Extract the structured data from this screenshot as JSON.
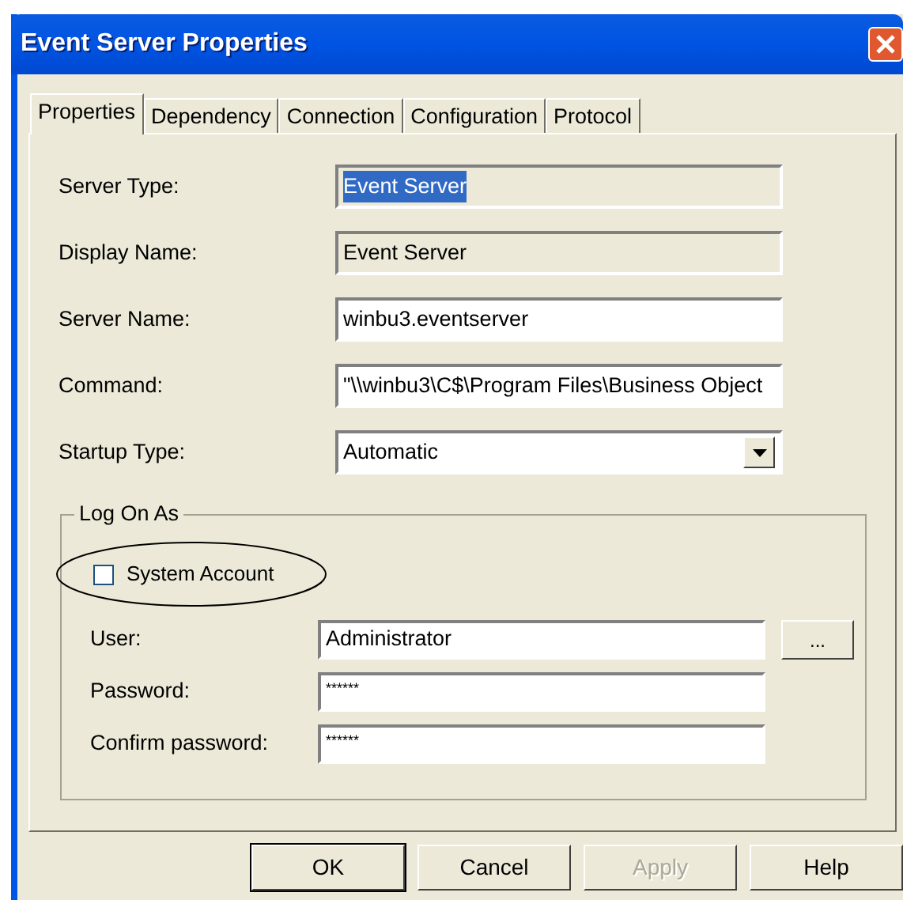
{
  "window": {
    "title": "Event Server Properties"
  },
  "tabs": [
    {
      "label": "Properties",
      "selected": true
    },
    {
      "label": "Dependency",
      "selected": false
    },
    {
      "label": "Connection",
      "selected": false
    },
    {
      "label": "Configuration",
      "selected": false
    },
    {
      "label": "Protocol",
      "selected": false
    }
  ],
  "fields": [
    {
      "label": "Server Type:",
      "value": "Event Server",
      "kind": "readonly",
      "text_highlighted": true
    },
    {
      "label": "Display Name:",
      "value": "Event Server",
      "kind": "readonly"
    },
    {
      "label": "Server Name:",
      "value": "winbu3.eventserver",
      "kind": "text"
    },
    {
      "label": "Command:",
      "value": "\"\\\\winbu3\\C$\\Program Files\\Business Object",
      "kind": "text"
    },
    {
      "label": "Startup Type:",
      "value": "Automatic",
      "kind": "dropdown"
    }
  ],
  "log_on_as": {
    "title": "Log On As",
    "system_account": {
      "label": "System Account",
      "checked": false,
      "circled": true
    },
    "fields": [
      {
        "label": "User:",
        "value": "Administrator",
        "browse_button": "..."
      },
      {
        "label": "Password:",
        "value": "******"
      },
      {
        "label": "Confirm password:",
        "value": "******"
      }
    ]
  },
  "buttons": [
    {
      "label": "OK",
      "default": true,
      "disabled": false
    },
    {
      "label": "Cancel",
      "default": false,
      "disabled": false
    },
    {
      "label": "Apply",
      "default": false,
      "disabled": true
    },
    {
      "label": "Help",
      "default": false,
      "disabled": false
    }
  ]
}
